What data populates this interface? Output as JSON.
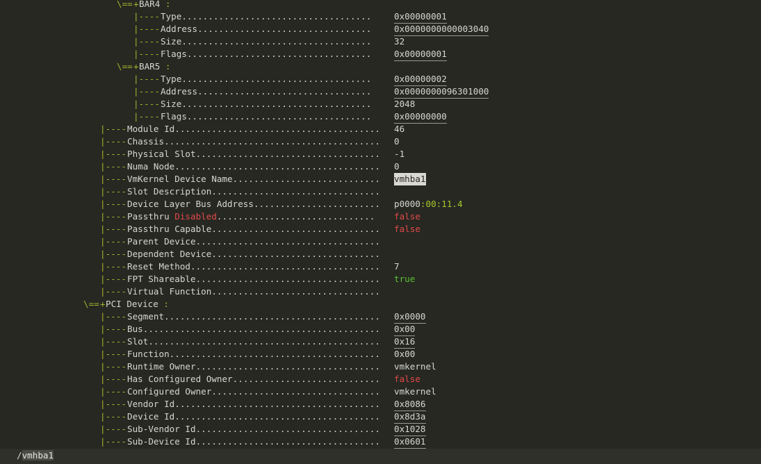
{
  "lines": [
    {
      "tree": "\\==+",
      "label": "BAR4",
      "colon": " :"
    },
    {
      "tree": "|----",
      "label": "Type",
      "dots": "....................................",
      "value": "0x00000001",
      "vstyle": "ul"
    },
    {
      "tree": "|----",
      "label": "Address",
      "dots": ".................................",
      "value": "0x0000000000003040",
      "vstyle": "ul"
    },
    {
      "tree": "|----",
      "label": "Size",
      "dots": "....................................",
      "value": "32",
      "vstyle": "plain"
    },
    {
      "tree": "|----",
      "label": "Flags",
      "dots": "...................................",
      "value": "0x00000001",
      "vstyle": "ul"
    },
    {
      "tree": "\\==+",
      "label": "BAR5",
      "colon": " :"
    },
    {
      "tree": "|----",
      "label": "Type",
      "dots": "....................................",
      "value": "0x00000002",
      "vstyle": "ul"
    },
    {
      "tree": "|----",
      "label": "Address",
      "dots": ".................................",
      "value": "0x0000000096301000",
      "vstyle": "ul"
    },
    {
      "tree": "|----",
      "label": "Size",
      "dots": "....................................",
      "value": "2048",
      "vstyle": "plain"
    },
    {
      "tree": "|----",
      "label": "Flags",
      "dots": "...................................",
      "value": "0x00000000",
      "vstyle": "ul"
    },
    {
      "tree": "|----",
      "label": "Module Id",
      "dots": ".......................................",
      "value": "46",
      "vstyle": "plain"
    },
    {
      "tree": "|----",
      "label": "Chassis",
      "dots": ".........................................",
      "value": "0",
      "vstyle": "plain"
    },
    {
      "tree": "|----",
      "label": "Physical Slot",
      "dots": "...................................",
      "value": "-1",
      "vstyle": "plain"
    },
    {
      "tree": "|----",
      "label": "Numa Node",
      "dots": ".......................................",
      "value": "0",
      "vstyle": "plain"
    },
    {
      "tree": "|----",
      "label": "VmKernel Device Name",
      "dots": "............................",
      "value": "vmhba1",
      "vstyle": "hl"
    },
    {
      "tree": "|----",
      "label": "Slot Description",
      "dots": "................................",
      "value": "",
      "vstyle": "plain"
    },
    {
      "tree": "|----",
      "label": "Device Layer Bus Address",
      "dots": "........................",
      "value": "p0000",
      "value2": ":00:11.4",
      "vstyle": "plain"
    },
    {
      "tree": "|----",
      "label": "Passthru ",
      "label2": "Disabled",
      "dots": "..............................",
      "value": "false",
      "vstyle": "false"
    },
    {
      "tree": "|----",
      "label": "Passthru Capable",
      "dots": "................................",
      "value": "false",
      "vstyle": "false"
    },
    {
      "tree": "|----",
      "label": "Parent Device",
      "dots": "...................................",
      "value": "",
      "vstyle": "plain"
    },
    {
      "tree": "|----",
      "label": "Dependent Device",
      "dots": "................................",
      "value": "",
      "vstyle": "plain"
    },
    {
      "tree": "|----",
      "label": "Reset Method",
      "dots": "....................................",
      "value": "7",
      "vstyle": "plain"
    },
    {
      "tree": "|----",
      "label": "FPT Shareable",
      "dots": "...................................",
      "value": "true",
      "vstyle": "true"
    },
    {
      "tree": "|----",
      "label": "Virtual Function",
      "dots": "................................",
      "value": "",
      "vstyle": "plain"
    },
    {
      "tree": "\\==+",
      "label": "PCI Device",
      "colon": " :"
    },
    {
      "tree": "|----",
      "label": "Segment",
      "dots": ".........................................",
      "value": "0x0000",
      "vstyle": "ul"
    },
    {
      "tree": "|----",
      "label": "Bus",
      "dots": ".............................................",
      "value": "0x00",
      "vstyle": "ul"
    },
    {
      "tree": "|----",
      "label": "Slot",
      "dots": "............................................",
      "value": "0x16",
      "vstyle": "ul"
    },
    {
      "tree": "|----",
      "label": "Function",
      "dots": "........................................",
      "value": "0x00",
      "vstyle": "plain"
    },
    {
      "tree": "|----",
      "label": "Runtime Owner",
      "dots": "...................................",
      "value": "vmkernel",
      "vstyle": "plain"
    },
    {
      "tree": "|----",
      "label": "Has Configured Owner",
      "dots": "............................",
      "value": "false",
      "vstyle": "false"
    },
    {
      "tree": "|----",
      "label": "Configured Owner",
      "dots": "................................",
      "value": "vmkernel",
      "vstyle": "plain"
    },
    {
      "tree": "|----",
      "label": "Vendor Id",
      "dots": ".......................................",
      "value": "0x8086",
      "vstyle": "ul"
    },
    {
      "tree": "|----",
      "label": "Device Id",
      "dots": ".......................................",
      "value": "0x8d3a",
      "vstyle": "ul"
    },
    {
      "tree": "|----",
      "label": "Sub-Vendor Id",
      "dots": "...................................",
      "value": "0x1028",
      "vstyle": "ul"
    },
    {
      "tree": "|----",
      "label": "Sub-Device Id",
      "dots": "...................................",
      "value": "0x0601",
      "vstyle": "ul"
    }
  ],
  "status_bar": {
    "prefix": "/",
    "search_term": "vmhba1"
  },
  "colors": {
    "background": "#272822",
    "tree": "#a6b32c",
    "false": "#e04a4a",
    "true": "#59c135"
  }
}
